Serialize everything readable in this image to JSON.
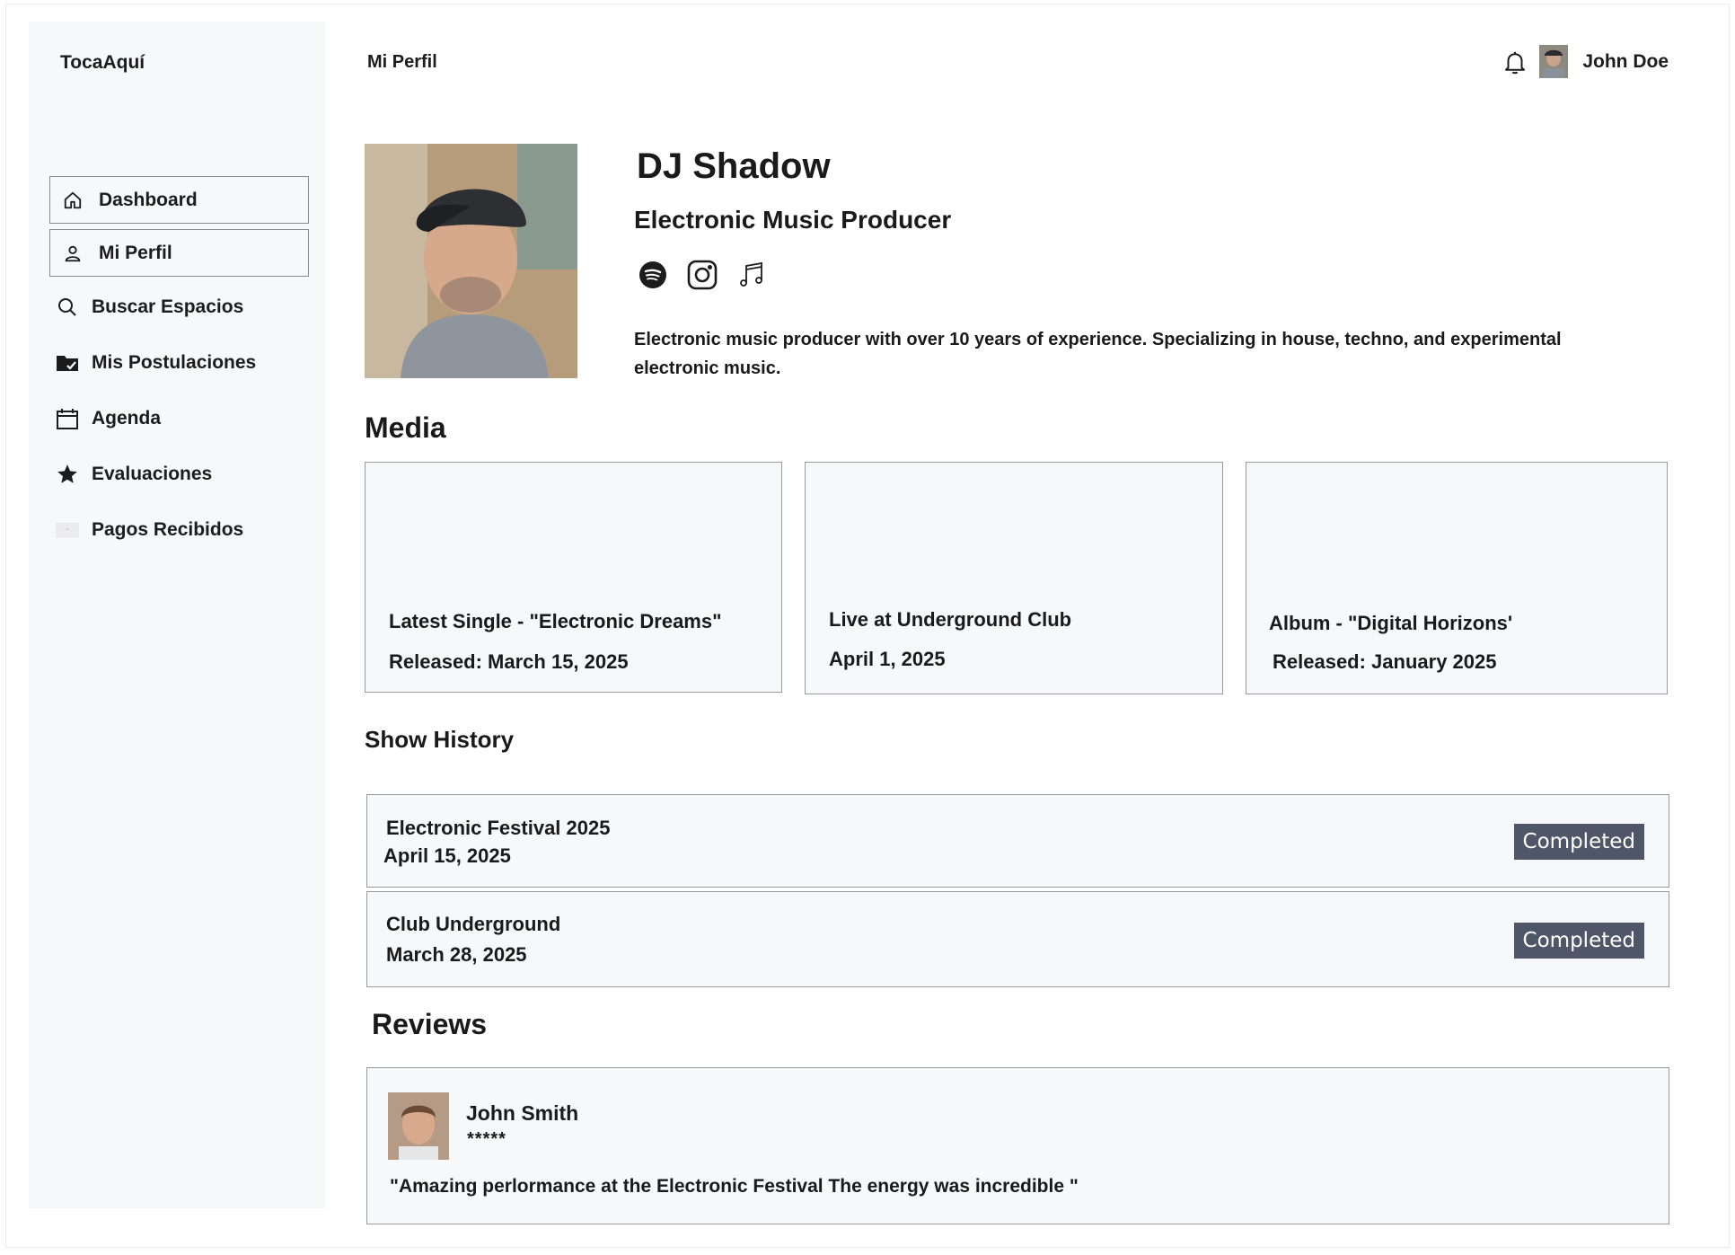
{
  "sidebar": {
    "brand": "TocaAquí",
    "items": [
      {
        "label": "Dashboard",
        "icon": "home-icon"
      },
      {
        "label": "Mi Perfil",
        "icon": "user-icon"
      },
      {
        "label": "Buscar Espacios",
        "icon": "search-icon"
      },
      {
        "label": "Mis Postulaciones",
        "icon": "folder-check-icon"
      },
      {
        "label": "Agenda",
        "icon": "calendar-icon"
      },
      {
        "label": "Evaluaciones",
        "icon": "star-icon"
      },
      {
        "label": "Pagos Recibidos",
        "icon": "payment-icon"
      }
    ]
  },
  "header": {
    "title": "Mi Perfil",
    "user_name": "John Doe"
  },
  "profile": {
    "name": "DJ Shadow",
    "role": "Electronic Music Producer",
    "socials": [
      "spotify-icon",
      "instagram-icon",
      "music-note-icon"
    ],
    "bio": "Electronic music producer with over 10 years of experience. Specializing in house, techno, and experimental electronic music."
  },
  "media": {
    "heading": "Media",
    "items": [
      {
        "title": "Latest Single - \"Electronic Dreams\"",
        "subtitle": "Released: March 15, 2025"
      },
      {
        "title": "Live at Underground Club",
        "subtitle": "April 1, 2025"
      },
      {
        "title": "Album - \"Digital Horizons'",
        "subtitle": "Released: January 2025"
      }
    ]
  },
  "history": {
    "heading": "Show History",
    "items": [
      {
        "title": "Electronic Festival 2025",
        "date": "April 15, 2025",
        "status": "Completed"
      },
      {
        "title": "Club Underground",
        "date": "March 28, 2025",
        "status": "Completed"
      }
    ]
  },
  "reviews": {
    "heading": "Reviews",
    "items": [
      {
        "name": "John Smith",
        "stars": "*****",
        "text": "\"Amazing perlormance at the Electronic Festival  The energy was incredible \""
      }
    ]
  },
  "colors": {
    "sidebar_bg": "#f7f8fa",
    "badge_bg": "#4f5667",
    "card_border": "#9a9a9a"
  }
}
